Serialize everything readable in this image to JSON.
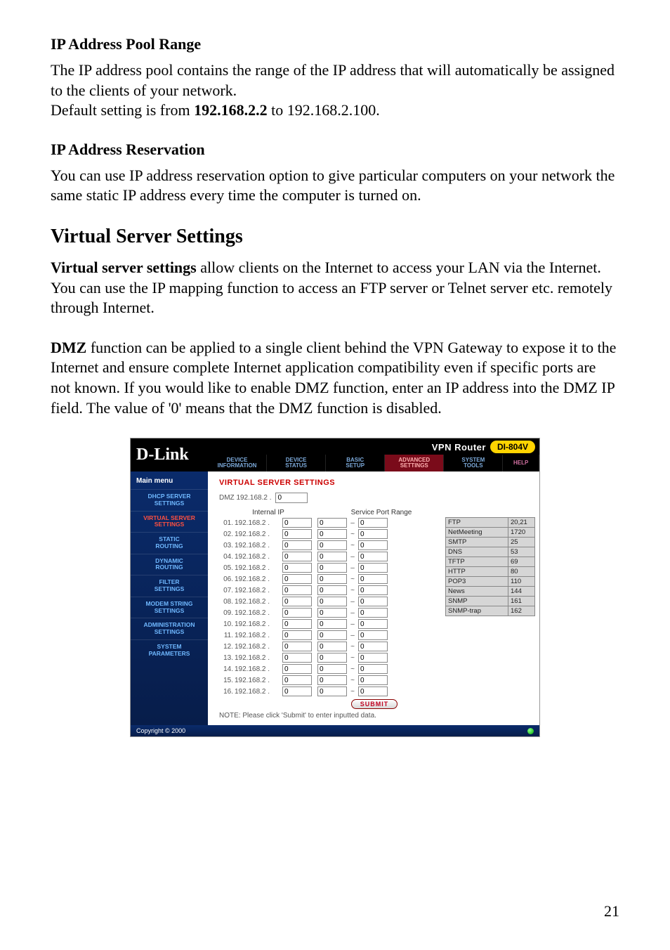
{
  "doc": {
    "h_pool": "IP Address Pool Range",
    "p_pool_1": "The IP address pool contains the range of the IP address that will automatically be assigned to the clients of your network.",
    "p_pool_2a": "Default setting is from ",
    "p_pool_2b": "192.168.2.2",
    "p_pool_2c": " to 192.168.2.100.",
    "h_res": "IP Address Reservation",
    "p_res": "You can use IP address reservation option to give particular computers on your network the same static IP address every time the computer is turned on.",
    "h_vs": "Virtual Server Settings",
    "p_vs_1a": "Virtual server settings",
    "p_vs_1b": " allow clients on the Internet to access your LAN via the Internet. You can use the IP mapping function to access an FTP server or Telnet server etc. remotely through Internet.",
    "p_vs_2a": "DMZ",
    "p_vs_2b": " function can be applied to a single client behind the VPN Gateway to expose it to the Internet and ensure complete Internet application compatibility even if specific ports are not known. If you would like to enable DMZ function, enter an IP address into the DMZ IP field. The value of '0' means that the DMZ function is disabled.",
    "page_num": "21"
  },
  "shot": {
    "logo": "D-Link",
    "router_name": "VPN Router",
    "model": "DI-804V",
    "tabs": [
      "DEVICE\nINFORMATION",
      "DEVICE\nSTATUS",
      "BASIC\nSETUP",
      "ADVANCED\nSETTINGS",
      "SYSTEM\nTOOLS",
      "HELP"
    ],
    "active_tab_index": 3,
    "side_head": "Main menu",
    "side_items": [
      "DHCP SERVER\nSETTINGS",
      "VIRTUAL SERVER\nSETTINGS",
      "STATIC\nROUTING",
      "DYNAMIC\nROUTING",
      "FILTER\nSETTINGS",
      "MODEM STRING\nSETTINGS",
      "ADMINISTRATION\nSETTINGS",
      "SYSTEM\nPARAMETERS"
    ],
    "side_selected_index": 1,
    "vs_title": "VIRTUAL SERVER SETTINGS",
    "dmz_label": "DMZ  192.168.2 .",
    "dmz_value": "0",
    "col_internal": "Internal IP",
    "col_range": "Service Port Range",
    "row_prefix": "192.168.2 .",
    "rows": [
      {
        "n": "01",
        "ip": "0",
        "p1": "0",
        "sep": "–",
        "p2": "0"
      },
      {
        "n": "02",
        "ip": "0",
        "p1": "0",
        "sep": "~",
        "p2": "0"
      },
      {
        "n": "03",
        "ip": "0",
        "p1": "0",
        "sep": "~",
        "p2": "0"
      },
      {
        "n": "04",
        "ip": "0",
        "p1": "0",
        "sep": "–",
        "p2": "0"
      },
      {
        "n": "05",
        "ip": "0",
        "p1": "0",
        "sep": "–",
        "p2": "0"
      },
      {
        "n": "06",
        "ip": "0",
        "p1": "0",
        "sep": "~",
        "p2": "0"
      },
      {
        "n": "07",
        "ip": "0",
        "p1": "0",
        "sep": "~",
        "p2": "0"
      },
      {
        "n": "08",
        "ip": "0",
        "p1": "0",
        "sep": "–",
        "p2": "0"
      },
      {
        "n": "09",
        "ip": "0",
        "p1": "0",
        "sep": "–",
        "p2": "0"
      },
      {
        "n": "10",
        "ip": "0",
        "p1": "0",
        "sep": "–",
        "p2": "0"
      },
      {
        "n": "11",
        "ip": "0",
        "p1": "0",
        "sep": "–",
        "p2": "0"
      },
      {
        "n": "12",
        "ip": "0",
        "p1": "0",
        "sep": "~",
        "p2": "0"
      },
      {
        "n": "13",
        "ip": "0",
        "p1": "0",
        "sep": "~",
        "p2": "0"
      },
      {
        "n": "14",
        "ip": "0",
        "p1": "0",
        "sep": "~",
        "p2": "0"
      },
      {
        "n": "15",
        "ip": "0",
        "p1": "0",
        "sep": "~",
        "p2": "0"
      },
      {
        "n": "16",
        "ip": "0",
        "p1": "0",
        "sep": "~",
        "p2": "0"
      }
    ],
    "submit": "SUBMIT",
    "note": "NOTE: Please click 'Submit' to enter inputted data.",
    "services": [
      {
        "name": "FTP",
        "port": "20,21"
      },
      {
        "name": "NetMeeting",
        "port": "1720"
      },
      {
        "name": "SMTP",
        "port": "25"
      },
      {
        "name": "DNS",
        "port": "53"
      },
      {
        "name": "TFTP",
        "port": "69"
      },
      {
        "name": "HTTP",
        "port": "80"
      },
      {
        "name": "POP3",
        "port": "110"
      },
      {
        "name": "News",
        "port": "144"
      },
      {
        "name": "SNMP",
        "port": "161"
      },
      {
        "name": "SNMP-trap",
        "port": "162"
      }
    ],
    "copyright": "Copyright © 2000"
  }
}
